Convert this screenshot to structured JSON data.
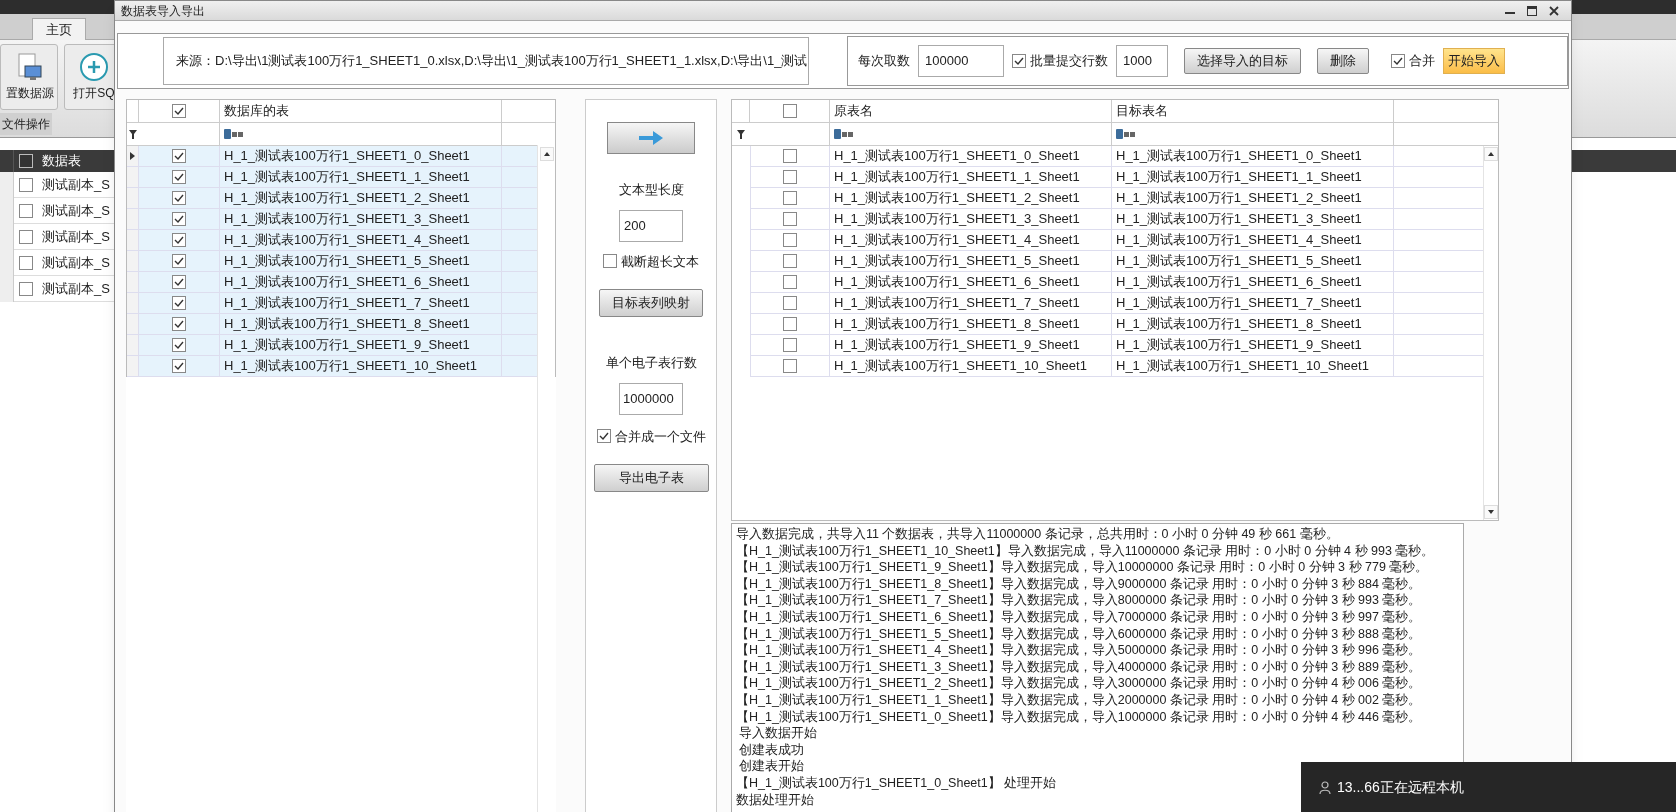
{
  "background_app": {
    "tab": {
      "label": "主页",
      "selected": true
    },
    "ribbon_buttons": [
      {
        "label": "置数据源",
        "kind": "datasource"
      },
      {
        "label": "打开SQ",
        "kind": "open"
      }
    ],
    "ribbon_group": "文件操作",
    "grid": {
      "header_checked": false,
      "column": "数据表",
      "rows": [
        {
          "name": "测试副本_S",
          "checked": false
        },
        {
          "name": "测试副本_S",
          "checked": false
        },
        {
          "name": "测试副本_S",
          "checked": false
        },
        {
          "name": "测试副本_S",
          "checked": false
        },
        {
          "name": "测试副本_S",
          "checked": false
        }
      ]
    }
  },
  "dialog": {
    "title": "数据表导入导出",
    "source": "来源：D:\\导出\\1测试表100万行1_SHEET1_0.xlsx,D:\\导出\\1_测试表100万行1_SHEET1_1.xlsx,D:\\导出\\1_测试",
    "toolbar": [
      {
        "kind": "label",
        "text": "每次取数"
      },
      {
        "kind": "input",
        "text": "100000"
      },
      {
        "kind": "checkbox",
        "text": "批量提交行数",
        "checked": true
      },
      {
        "kind": "input",
        "text": "1000"
      },
      {
        "kind": "button",
        "text": "选择导入的目标"
      },
      {
        "kind": "button",
        "text": "删除"
      },
      {
        "kind": "checkbox",
        "text": "合并",
        "checked": true
      },
      {
        "kind": "primary",
        "text": "开始导入"
      }
    ],
    "left_grid": {
      "header_checked": true,
      "column": "数据库的表",
      "rows": [
        {
          "name": "H_1_测试表100万行1_SHEET1_0_Sheet1",
          "checked": true,
          "selected": true,
          "current": true
        },
        {
          "name": "H_1_测试表100万行1_SHEET1_1_Sheet1",
          "checked": true,
          "selected": true,
          "current": false
        },
        {
          "name": "H_1_测试表100万行1_SHEET1_2_Sheet1",
          "checked": true,
          "selected": true,
          "current": false
        },
        {
          "name": "H_1_测试表100万行1_SHEET1_3_Sheet1",
          "checked": true,
          "selected": true,
          "current": false
        },
        {
          "name": "H_1_测试表100万行1_SHEET1_4_Sheet1",
          "checked": true,
          "selected": true,
          "current": false
        },
        {
          "name": "H_1_测试表100万行1_SHEET1_5_Sheet1",
          "checked": true,
          "selected": true,
          "current": false
        },
        {
          "name": "H_1_测试表100万行1_SHEET1_6_Sheet1",
          "checked": true,
          "selected": true,
          "current": false
        },
        {
          "name": "H_1_测试表100万行1_SHEET1_7_Sheet1",
          "checked": true,
          "selected": true,
          "current": false
        },
        {
          "name": "H_1_测试表100万行1_SHEET1_8_Sheet1",
          "checked": true,
          "selected": true,
          "current": false
        },
        {
          "name": "H_1_测试表100万行1_SHEET1_9_Sheet1",
          "checked": true,
          "selected": true,
          "current": false
        },
        {
          "name": "H_1_测试表100万行1_SHEET1_10_Sheet1",
          "checked": true,
          "selected": true,
          "current": false
        }
      ]
    },
    "middle": {
      "text_length_label": "文本型长度",
      "text_length": "200",
      "truncate": {
        "label": "截断超长文本",
        "checked": false
      },
      "mapping_button": "目标表列映射",
      "rows_label": "单个电子表行数",
      "rows_per_sheet": "1000000",
      "merge_file": {
        "label": "合并成一个文件",
        "checked": true
      },
      "export_button": "导出电子表"
    },
    "right_grid": {
      "header_checked": false,
      "columns": [
        "原表名",
        "目标表名"
      ],
      "rows": [
        {
          "source": "H_1_测试表100万行1_SHEET1_0_Sheet1",
          "target": "H_1_测试表100万行1_SHEET1_0_Sheet1",
          "checked": false
        },
        {
          "source": "H_1_测试表100万行1_SHEET1_1_Sheet1",
          "target": "H_1_测试表100万行1_SHEET1_1_Sheet1",
          "checked": false
        },
        {
          "source": "H_1_测试表100万行1_SHEET1_2_Sheet1",
          "target": "H_1_测试表100万行1_SHEET1_2_Sheet1",
          "checked": false
        },
        {
          "source": "H_1_测试表100万行1_SHEET1_3_Sheet1",
          "target": "H_1_测试表100万行1_SHEET1_3_Sheet1",
          "checked": false
        },
        {
          "source": "H_1_测试表100万行1_SHEET1_4_Sheet1",
          "target": "H_1_测试表100万行1_SHEET1_4_Sheet1",
          "checked": false
        },
        {
          "source": "H_1_测试表100万行1_SHEET1_5_Sheet1",
          "target": "H_1_测试表100万行1_SHEET1_5_Sheet1",
          "checked": false
        },
        {
          "source": "H_1_测试表100万行1_SHEET1_6_Sheet1",
          "target": "H_1_测试表100万行1_SHEET1_6_Sheet1",
          "checked": false
        },
        {
          "source": "H_1_测试表100万行1_SHEET1_7_Sheet1",
          "target": "H_1_测试表100万行1_SHEET1_7_Sheet1",
          "checked": false
        },
        {
          "source": "H_1_测试表100万行1_SHEET1_8_Sheet1",
          "target": "H_1_测试表100万行1_SHEET1_8_Sheet1",
          "checked": false
        },
        {
          "source": "H_1_测试表100万行1_SHEET1_9_Sheet1",
          "target": "H_1_测试表100万行1_SHEET1_9_Sheet1",
          "checked": false
        },
        {
          "source": "H_1_测试表100万行1_SHEET1_10_Sheet1",
          "target": "H_1_测试表100万行1_SHEET1_10_Sheet1",
          "checked": false
        }
      ]
    },
    "log": [
      "导入数据完成，共导入11 个数据表，共导入11000000 条记录，总共用时：0 小时 0 分钟 49 秒 661 毫秒。",
      "【H_1_测试表100万行1_SHEET1_10_Sheet1】导入数据完成，导入11000000 条记录 用时：0 小时 0 分钟 4 秒 993 毫秒。",
      "【H_1_测试表100万行1_SHEET1_9_Sheet1】导入数据完成，导入10000000 条记录 用时：0 小时 0 分钟 3 秒 779 毫秒。",
      "【H_1_测试表100万行1_SHEET1_8_Sheet1】导入数据完成，导入9000000 条记录 用时：0 小时 0 分钟 3 秒 884 毫秒。",
      "【H_1_测试表100万行1_SHEET1_7_Sheet1】导入数据完成，导入8000000 条记录 用时：0 小时 0 分钟 3 秒 993 毫秒。",
      "【H_1_测试表100万行1_SHEET1_6_Sheet1】导入数据完成，导入7000000 条记录 用时：0 小时 0 分钟 3 秒 997 毫秒。",
      "【H_1_测试表100万行1_SHEET1_5_Sheet1】导入数据完成，导入6000000 条记录 用时：0 小时 0 分钟 3 秒 888 毫秒。",
      "【H_1_测试表100万行1_SHEET1_4_Sheet1】导入数据完成，导入5000000 条记录 用时：0 小时 0 分钟 3 秒 996 毫秒。",
      "【H_1_测试表100万行1_SHEET1_3_Sheet1】导入数据完成，导入4000000 条记录 用时：0 小时 0 分钟 3 秒 889 毫秒。",
      "【H_1_测试表100万行1_SHEET1_2_Sheet1】导入数据完成，导入3000000 条记录 用时：0 小时 0 分钟 4 秒 006 毫秒。",
      "【H_1_测试表100万行1_SHEET1_1_Sheet1】导入数据完成，导入2000000 条记录 用时：0 小时 0 分钟 4 秒 002 毫秒。",
      "【H_1_测试表100万行1_SHEET1_0_Sheet1】导入数据完成，导入1000000 条记录 用时：0 小时 0 分钟 4 秒 446 毫秒。",
      " 导入数据开始",
      " 创建表成功",
      " 创建表开始",
      "【H_1_测试表100万行1_SHEET1_0_Sheet1】 处理开始",
      "数据处理开始"
    ]
  },
  "notification": {
    "text": "13...66正在远程本机"
  }
}
